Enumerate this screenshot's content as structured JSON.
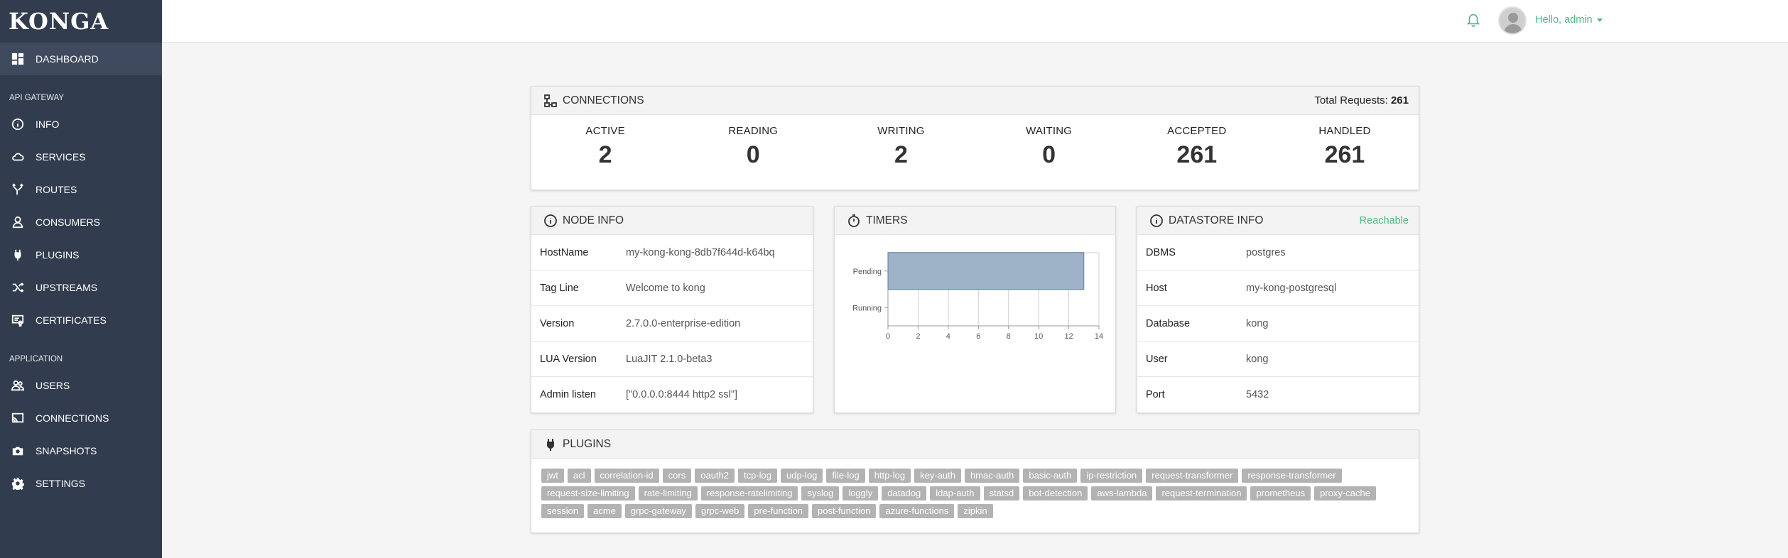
{
  "app": {
    "logo": "KONGA"
  },
  "sidebar": {
    "dashboard": "DASHBOARD",
    "section_api": "API GATEWAY",
    "api_items": [
      {
        "label": "INFO",
        "icon": "info-icon"
      },
      {
        "label": "SERVICES",
        "icon": "cloud-icon"
      },
      {
        "label": "ROUTES",
        "icon": "fork-icon"
      },
      {
        "label": "CONSUMERS",
        "icon": "user-icon"
      },
      {
        "label": "PLUGINS",
        "icon": "plug-icon"
      },
      {
        "label": "UPSTREAMS",
        "icon": "shuffle-icon"
      },
      {
        "label": "CERTIFICATES",
        "icon": "certificate-icon"
      }
    ],
    "section_app": "APPLICATION",
    "app_items": [
      {
        "label": "USERS",
        "icon": "users-icon"
      },
      {
        "label": "CONNECTIONS",
        "icon": "cast-icon"
      },
      {
        "label": "SNAPSHOTS",
        "icon": "camera-icon"
      },
      {
        "label": "SETTINGS",
        "icon": "gear-icon"
      }
    ]
  },
  "topbar": {
    "greeting": "Hello, admin"
  },
  "connections": {
    "title": "CONNECTIONS",
    "total_label": "Total Requests:",
    "total_value": "261",
    "stats": [
      {
        "label": "ACTIVE",
        "value": "2"
      },
      {
        "label": "READING",
        "value": "0"
      },
      {
        "label": "WRITING",
        "value": "2"
      },
      {
        "label": "WAITING",
        "value": "0"
      },
      {
        "label": "ACCEPTED",
        "value": "261"
      },
      {
        "label": "HANDLED",
        "value": "261"
      }
    ]
  },
  "node_info": {
    "title": "NODE INFO",
    "rows": [
      {
        "key": "HostName",
        "value": "my-kong-kong-8db7f644d-k64bq"
      },
      {
        "key": "Tag Line",
        "value": "Welcome to kong"
      },
      {
        "key": "Version",
        "value": "2.7.0.0-enterprise-edition"
      },
      {
        "key": "LUA Version",
        "value": "LuaJIT 2.1.0-beta3"
      },
      {
        "key": "Admin listen",
        "value": "[\"0.0.0.0:8444 http2 ssl\"]"
      }
    ]
  },
  "timers": {
    "title": "TIMERS"
  },
  "chart_data": {
    "type": "bar",
    "orientation": "horizontal",
    "categories": [
      "Pending",
      "Running"
    ],
    "values": [
      13,
      0
    ],
    "xlim": [
      0,
      14
    ],
    "xticks": [
      "0",
      "2",
      "4",
      "6",
      "8",
      "10",
      "12",
      "14"
    ],
    "grid": true,
    "color": "#9fb3c8"
  },
  "datastore": {
    "title": "DATASTORE INFO",
    "status": "Reachable",
    "rows": [
      {
        "key": "DBMS",
        "value": "postgres"
      },
      {
        "key": "Host",
        "value": "my-kong-postgresql"
      },
      {
        "key": "Database",
        "value": "kong"
      },
      {
        "key": "User",
        "value": "kong"
      },
      {
        "key": "Port",
        "value": "5432"
      }
    ]
  },
  "plugins": {
    "title": "PLUGINS",
    "tags": [
      "jwt",
      "acl",
      "correlation-id",
      "cors",
      "oauth2",
      "tcp-log",
      "udp-log",
      "file-log",
      "http-log",
      "key-auth",
      "hmac-auth",
      "basic-auth",
      "ip-restriction",
      "request-transformer",
      "response-transformer",
      "request-size-limiting",
      "rate-limiting",
      "response-ratelimiting",
      "syslog",
      "loggly",
      "datadog",
      "ldap-auth",
      "statsd",
      "bot-detection",
      "aws-lambda",
      "request-termination",
      "prometheus",
      "proxy-cache",
      "session",
      "acme",
      "grpc-gateway",
      "grpc-web",
      "pre-function",
      "post-function",
      "azure-functions",
      "zipkin"
    ]
  }
}
